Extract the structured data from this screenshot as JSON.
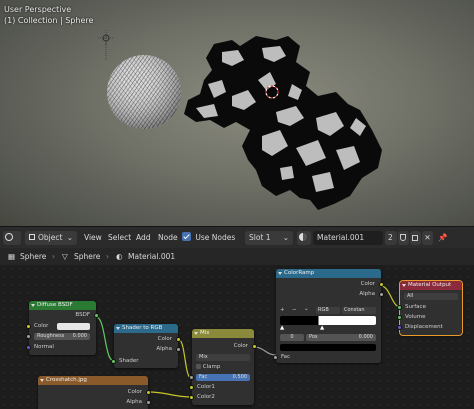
{
  "viewport": {
    "title": "User Perspective",
    "subtitle": "(1) Collection | Sphere"
  },
  "header": {
    "editor_type_icon": "node-editor-icon",
    "object_mode": "Object",
    "menus": [
      "View",
      "Select",
      "Add",
      "Node"
    ],
    "use_nodes_label": "Use Nodes",
    "use_nodes_checked": true,
    "slot": "Slot 1",
    "material_name": "Material.001",
    "user_count": "2"
  },
  "breadcrumb": {
    "object": "Sphere",
    "mesh": "Sphere",
    "material": "Material.001"
  },
  "nodes": {
    "diffuse": {
      "title": "Diffuse BSDF",
      "output": "BSDF",
      "color_label": "Color",
      "roughness_label": "Roughness",
      "roughness_value": "0.000",
      "normal_label": "Normal"
    },
    "shader_rgb": {
      "title": "Shader to RGB",
      "out_color": "Color",
      "out_alpha": "Alpha",
      "in_shader": "Shader"
    },
    "mix": {
      "title": "Mix",
      "out_color": "Color",
      "blend": "Mix",
      "clamp": "Clamp",
      "fac_label": "Fac",
      "fac_value": "0.500",
      "color1": "Color1",
      "color2": "Color2"
    },
    "colorramp": {
      "title": "ColorRamp",
      "out_color": "Color",
      "out_alpha": "Alpha",
      "color_mode": "RGB",
      "interpolation": "Constan",
      "stop_index": "0",
      "pos_label": "Pos",
      "pos_value": "0.000",
      "in_fac": "Fac"
    },
    "output": {
      "title": "Material Output",
      "target": "All",
      "surface": "Surface",
      "volume": "Volume",
      "displacement": "Displacement"
    },
    "image": {
      "title": "Crosshatch.jpg",
      "out_color": "Color",
      "out_alpha": "Alpha"
    }
  },
  "colors": {
    "accent": "#4772b3",
    "shader_header": "#2a7a33",
    "converter_header": "#2b6a8a",
    "color_header": "#8a8a3a",
    "output_header": "#8a2a3a",
    "texture_header": "#8a5a2a",
    "selection": "#e89b2a"
  }
}
